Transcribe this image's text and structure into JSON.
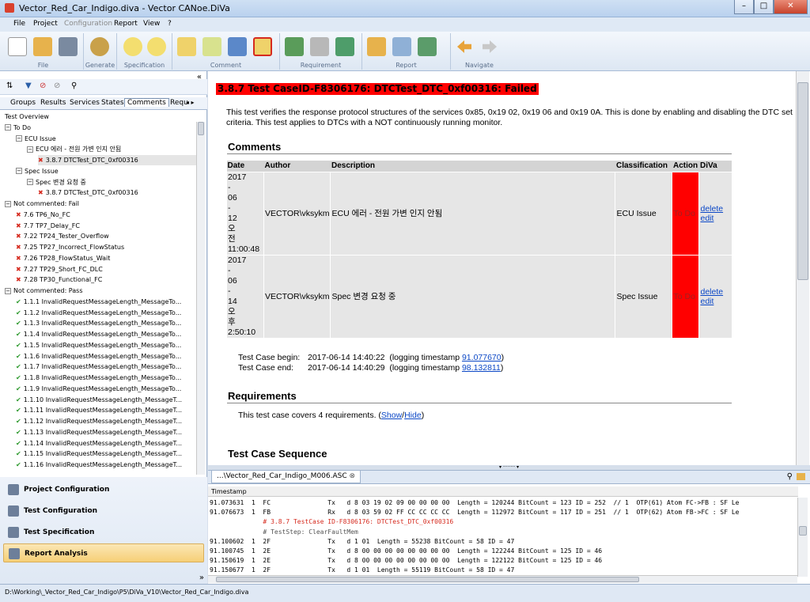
{
  "window": {
    "title": "Vector_Red_Car_Indigo.diva - Vector CANoe.DiVa",
    "min": "–",
    "max": "□",
    "close": "✕"
  },
  "menu": [
    "File",
    "Project",
    "Configuration",
    "Report",
    "View",
    "?"
  ],
  "ribbon": {
    "groups": [
      "File",
      "Generate",
      "Specification",
      "Comment",
      "Requirement",
      "Report",
      "Navigate"
    ]
  },
  "left": {
    "tabs": [
      "Groups",
      "Results",
      "Services",
      "States",
      "Comments",
      "Requ"
    ],
    "active_tab": "Comments",
    "tree": [
      {
        "indent": 0,
        "exp": "",
        "icon": "",
        "label": "Test Overview"
      },
      {
        "indent": 0,
        "exp": "−",
        "icon": "",
        "label": "To Do"
      },
      {
        "indent": 1,
        "exp": "−",
        "icon": "",
        "label": "ECU Issue"
      },
      {
        "indent": 2,
        "exp": "−",
        "icon": "",
        "label": "ECU 에러 - 전원 가변 인지 안됨"
      },
      {
        "indent": 3,
        "exp": "",
        "icon": "x",
        "label": "3.8.7 DTCTest_DTC_0xf00316",
        "sel": true
      },
      {
        "indent": 1,
        "exp": "−",
        "icon": "",
        "label": "Spec Issue"
      },
      {
        "indent": 2,
        "exp": "−",
        "icon": "",
        "label": "Spec 변경 요청 중"
      },
      {
        "indent": 3,
        "exp": "",
        "icon": "x",
        "label": "3.8.7 DTCTest_DTC_0xf00316"
      },
      {
        "indent": 0,
        "exp": "−",
        "icon": "",
        "label": "Not commented: Fail"
      },
      {
        "indent": 1,
        "exp": "",
        "icon": "x",
        "label": "7.6 TP6_No_FC"
      },
      {
        "indent": 1,
        "exp": "",
        "icon": "x",
        "label": "7.7 TP7_Delay_FC"
      },
      {
        "indent": 1,
        "exp": "",
        "icon": "x",
        "label": "7.22 TP24_Tester_Overflow"
      },
      {
        "indent": 1,
        "exp": "",
        "icon": "x",
        "label": "7.25 TP27_Incorrect_FlowStatus"
      },
      {
        "indent": 1,
        "exp": "",
        "icon": "x",
        "label": "7.26 TP28_FlowStatus_Wait"
      },
      {
        "indent": 1,
        "exp": "",
        "icon": "x",
        "label": "7.27 TP29_Short_FC_DLC"
      },
      {
        "indent": 1,
        "exp": "",
        "icon": "x",
        "label": "7.28 TP30_Functional_FC"
      },
      {
        "indent": 0,
        "exp": "−",
        "icon": "",
        "label": "Not commented: Pass"
      },
      {
        "indent": 1,
        "exp": "",
        "icon": "chk",
        "label": "1.1.1 InvalidRequestMessageLength_MessageTo..."
      },
      {
        "indent": 1,
        "exp": "",
        "icon": "chk",
        "label": "1.1.2 InvalidRequestMessageLength_MessageTo..."
      },
      {
        "indent": 1,
        "exp": "",
        "icon": "chk",
        "label": "1.1.3 InvalidRequestMessageLength_MessageTo..."
      },
      {
        "indent": 1,
        "exp": "",
        "icon": "chk",
        "label": "1.1.4 InvalidRequestMessageLength_MessageTo..."
      },
      {
        "indent": 1,
        "exp": "",
        "icon": "chk",
        "label": "1.1.5 InvalidRequestMessageLength_MessageTo..."
      },
      {
        "indent": 1,
        "exp": "",
        "icon": "chk",
        "label": "1.1.6 InvalidRequestMessageLength_MessageTo..."
      },
      {
        "indent": 1,
        "exp": "",
        "icon": "chk",
        "label": "1.1.7 InvalidRequestMessageLength_MessageTo..."
      },
      {
        "indent": 1,
        "exp": "",
        "icon": "chk",
        "label": "1.1.8 InvalidRequestMessageLength_MessageTo..."
      },
      {
        "indent": 1,
        "exp": "",
        "icon": "chk",
        "label": "1.1.9 InvalidRequestMessageLength_MessageTo..."
      },
      {
        "indent": 1,
        "exp": "",
        "icon": "chk",
        "label": "1.1.10 InvalidRequestMessageLength_MessageT..."
      },
      {
        "indent": 1,
        "exp": "",
        "icon": "chk",
        "label": "1.1.11 InvalidRequestMessageLength_MessageT..."
      },
      {
        "indent": 1,
        "exp": "",
        "icon": "chk",
        "label": "1.1.12 InvalidRequestMessageLength_MessageT..."
      },
      {
        "indent": 1,
        "exp": "",
        "icon": "chk",
        "label": "1.1.13 InvalidRequestMessageLength_MessageT..."
      },
      {
        "indent": 1,
        "exp": "",
        "icon": "chk",
        "label": "1.1.14 InvalidRequestMessageLength_MessageT..."
      },
      {
        "indent": 1,
        "exp": "",
        "icon": "chk",
        "label": "1.1.15 InvalidRequestMessageLength_MessageT..."
      },
      {
        "indent": 1,
        "exp": "",
        "icon": "chk",
        "label": "1.1.16 InvalidRequestMessageLength_MessageT..."
      }
    ],
    "nav": [
      "Project Configuration",
      "Test Configuration",
      "Test Specification",
      "Report Analysis"
    ],
    "nav_active": "Report Analysis"
  },
  "main": {
    "heading": "3.8.7 Test CaseID-F8306176: DTCTest_DTC_0xf00316: Failed",
    "description": "This test verifies the response protocol structures of the services 0x85, 0x19 02, 0x19 06 and 0x19 0A. This is done by enabling and disabling the DTC set criteria. This test applies to DTCs with a NOT continuously running monitor.",
    "comments_title": "Comments",
    "columns": [
      "Date",
      "Author",
      "Description",
      "Classification",
      "Action",
      "DiVa"
    ],
    "rows": [
      {
        "date": [
          "2017",
          "-",
          "06",
          "-",
          "12",
          "오",
          "전",
          "11:00:48"
        ],
        "author": "VECTOR\\vksykm",
        "desc": "ECU 에러 - 전원 가변 인지 안됨",
        "class": "ECU Issue",
        "action": "To Do",
        "del": "delete",
        "edit": "edit"
      },
      {
        "date": [
          "2017",
          "-",
          "06",
          "-",
          "14",
          "오",
          "후",
          "2:50:10"
        ],
        "author": "VECTOR\\vksykm",
        "desc": "Spec 변경 요청 중",
        "class": "Spec Issue",
        "action": "To Do",
        "del": "delete",
        "edit": "edit"
      }
    ],
    "begin_label": "Test Case begin:",
    "begin_time": "2017-06-14 14:40:22",
    "begin_pre": "(logging timestamp ",
    "begin_ts": "91.077670",
    "begin_post": ")",
    "end_label": "Test Case end:",
    "end_time": "2017-06-14 14:40:29",
    "end_pre": "(logging timestamp ",
    "end_ts": "98.132811",
    "end_post": ")",
    "req_title": "Requirements",
    "req_text": "This test case covers 4 requirements. (",
    "req_show": "Show",
    "req_slash": "/",
    "req_hide": "Hide",
    "req_close": ")",
    "seq_title": "Test Case Sequence"
  },
  "log": {
    "tab": "...\\Vector_Red_Car_Indigo_M006.ASC",
    "column": "Timestamp",
    "rows": [
      {
        "t": "91.073631  1  FC               Tx   d 8 03 19 02 09 00 00 00 00  Length = 120244 BitCount = 123 ID = 252  // 1  OTP(61) Atom FC->FB : SF Le",
        "c": ""
      },
      {
        "t": "91.076673  1  FB               Rx   d 8 03 59 02 FF CC CC CC CC  Length = 112972 BitCount = 117 ID = 251  // 1  OTP(62) Atom FB->FC : SF Le",
        "c": ""
      },
      {
        "t": "              # 3.8.7 TestCase ID-F8306176: DTCTest_DTC_0xf00316",
        "c": "red"
      },
      {
        "t": "              # TestStep: ClearFaultMem",
        "c": "gray"
      },
      {
        "t": "91.100602  1  2F               Tx   d 1 01  Length = 55238 BitCount = 58 ID = 47",
        "c": ""
      },
      {
        "t": "91.100745  1  2E               Tx   d 8 00 00 00 00 00 00 00 00  Length = 122244 BitCount = 125 ID = 46",
        "c": ""
      },
      {
        "t": "91.150619  1  2E               Tx   d 8 00 00 00 00 00 00 00 00  Length = 122122 BitCount = 125 ID = 46",
        "c": ""
      },
      {
        "t": "91.150677  1  2F               Tx   d 1 01  Length = 55119 BitCount = 58 ID = 47",
        "c": ""
      }
    ]
  },
  "status": {
    "path": "D:\\Working\\_Vector_Red_Car_Indigo\\P5\\DiVa_V10\\Vector_Red_Car_Indigo.diva"
  }
}
